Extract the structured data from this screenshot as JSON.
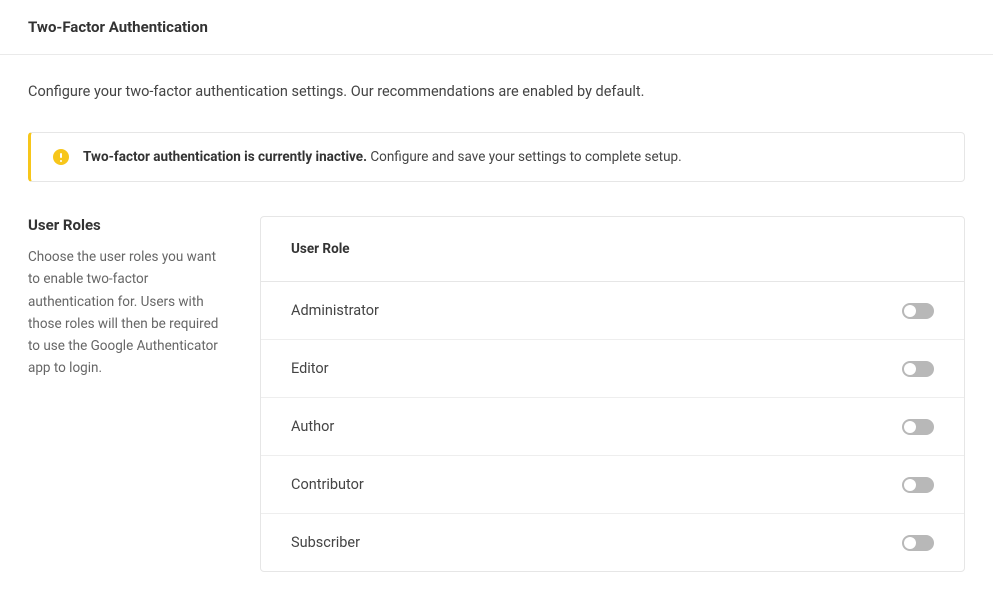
{
  "header": {
    "title": "Two-Factor Authentication"
  },
  "intro": "Configure your two-factor authentication settings. Our recommendations are enabled by default.",
  "alert": {
    "strong": "Two-factor authentication is currently inactive.",
    "rest": " Configure and save your settings to complete setup.",
    "icon": "warning-icon"
  },
  "section": {
    "title": "User Roles",
    "description": "Choose the user roles you want to enable two-factor authentication for. Users with those roles will then be required to use the Google Authenticator app to login.",
    "table_header": "User Role",
    "roles": [
      {
        "label": "Administrator",
        "enabled": false
      },
      {
        "label": "Editor",
        "enabled": false
      },
      {
        "label": "Author",
        "enabled": false
      },
      {
        "label": "Contributor",
        "enabled": false
      },
      {
        "label": "Subscriber",
        "enabled": false
      }
    ]
  }
}
